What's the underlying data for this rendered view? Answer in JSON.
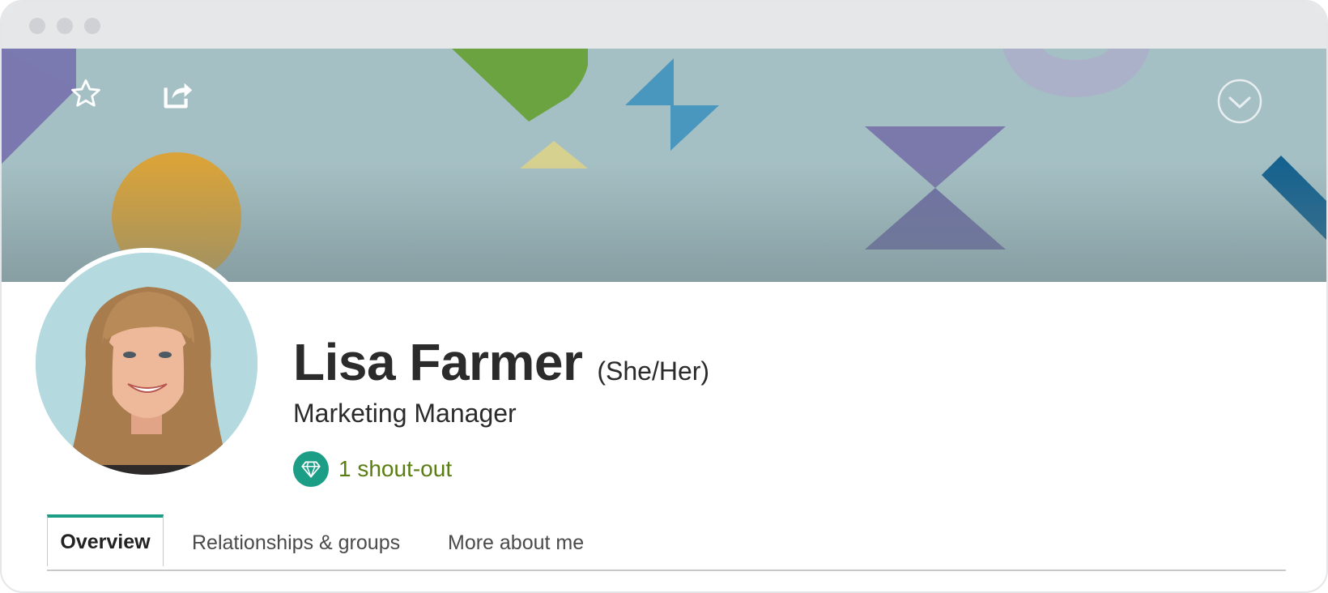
{
  "profile": {
    "name": "Lisa Farmer",
    "pronouns": "(She/Her)",
    "job_title": "Marketing Manager",
    "shoutout_label": "1 shout-out"
  },
  "tabs": [
    {
      "label": "Overview",
      "active": true
    },
    {
      "label": "Relationships & groups",
      "active": false
    },
    {
      "label": "More about me",
      "active": false
    }
  ],
  "icons": {
    "favorite": "star-icon",
    "share": "share-icon",
    "expand": "chevron-down-circle-icon",
    "shoutout": "diamond-icon"
  },
  "colors": {
    "accent": "#1b9d86",
    "shoutout_text": "#5a7d12",
    "banner_bg": "#a5c0c4"
  }
}
